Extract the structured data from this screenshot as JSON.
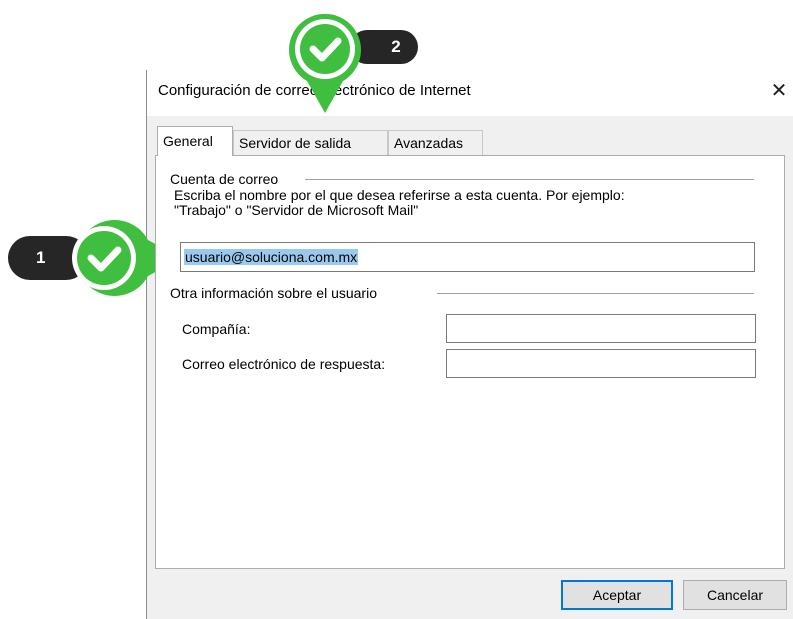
{
  "dialog": {
    "title": "Configuración de correo electrónico de Internet",
    "close_glyph": "✕"
  },
  "tabs": [
    {
      "label": "General",
      "active": true
    },
    {
      "label": "Servidor de salida",
      "active": false
    },
    {
      "label": "Avanzadas",
      "active": false
    }
  ],
  "account_group": {
    "title": "Cuenta de correo",
    "description_line1": "Escriba el nombre por el que desea referirse a esta cuenta. Por ejemplo:",
    "description_line2": "\"Trabajo\" o \"Servidor de Microsoft Mail\"",
    "account_name_value": "usuario@soluciona.com.mx"
  },
  "user_group": {
    "title": "Otra información sobre el usuario",
    "company_label": "Compañía:",
    "company_value": "",
    "reply_label": "Correo electrónico de respuesta:",
    "reply_value": ""
  },
  "buttons": {
    "ok": "Aceptar",
    "cancel": "Cancelar"
  },
  "annotations": {
    "step1": "1",
    "step2": "2",
    "accent_color": "#3fbe3f"
  }
}
